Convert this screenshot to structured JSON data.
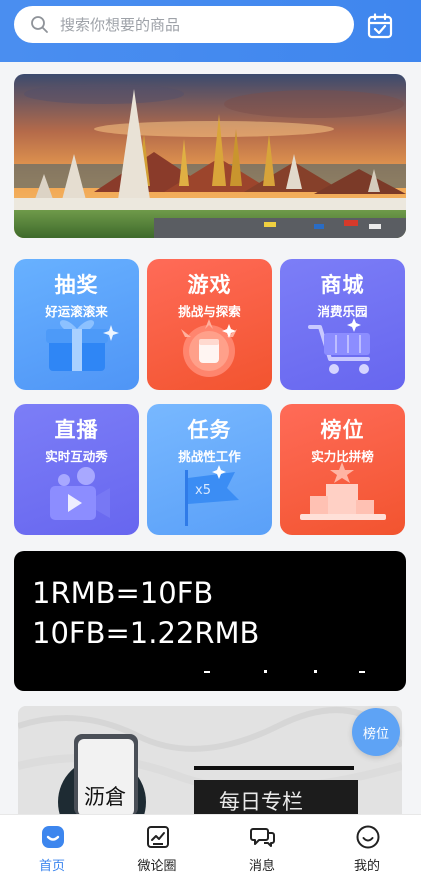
{
  "search": {
    "placeholder": "搜索你想要的商品"
  },
  "tiles": [
    {
      "title": "抽奖",
      "subtitle": "好运滚滚来"
    },
    {
      "title": "游戏",
      "subtitle": "挑战与探索"
    },
    {
      "title": "商城",
      "subtitle": "消费乐园"
    },
    {
      "title": "直播",
      "subtitle": "实时互动秀"
    },
    {
      "title": "任务",
      "subtitle": "挑战性工作",
      "flag_text": "x5"
    },
    {
      "title": "榜位",
      "subtitle": "实力比拼榜"
    }
  ],
  "rate": {
    "line1": "1RMB=10FB",
    "line2": "10FB=1.22RMB"
  },
  "column": {
    "logo_text": "沥倉",
    "title": "每日专栏",
    "badge": "榜位"
  },
  "bottom_nav": [
    {
      "label": "首页",
      "icon": "home-icon",
      "active": true
    },
    {
      "label": "微论圈",
      "icon": "chart-board-icon",
      "active": false
    },
    {
      "label": "消息",
      "icon": "chat-bubbles-icon",
      "active": false
    },
    {
      "label": "我的",
      "icon": "smiley-icon",
      "active": false
    }
  ],
  "colors": {
    "brand_blue": "#3d86ee",
    "tile_blue": "#5aa0f8",
    "tile_red": "#f2542f",
    "tile_purple": "#6766ef"
  }
}
